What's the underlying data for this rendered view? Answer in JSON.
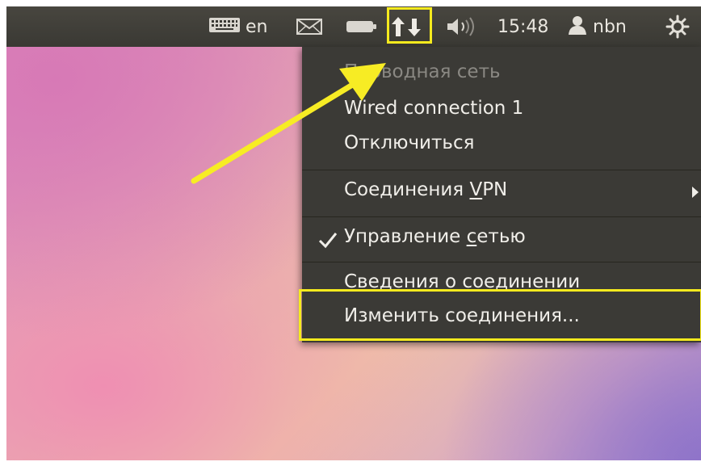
{
  "panel": {
    "keyboard_layout": "en",
    "time": "15:48",
    "username": "nbn",
    "icons": [
      "keyboard-icon",
      "mail-icon",
      "battery-icon",
      "network-updown-icon",
      "volume-icon",
      "user-icon",
      "power-gear-icon"
    ]
  },
  "network_menu": {
    "section_header": "Проводная сеть",
    "connection_name": "Wired connection 1",
    "disconnect": "Отключиться",
    "vpn": {
      "pre": "Соединения ",
      "accel": "V",
      "post": "PN"
    },
    "manage": {
      "pre": "Управление ",
      "accel": "с",
      "post": "етью"
    },
    "manage_checked": true,
    "info": "Сведения о соединении",
    "edit": "Изменить соединения..."
  },
  "annotation_colors": {
    "highlight": "#f5ea1e",
    "arrow": "#f7ec24"
  }
}
